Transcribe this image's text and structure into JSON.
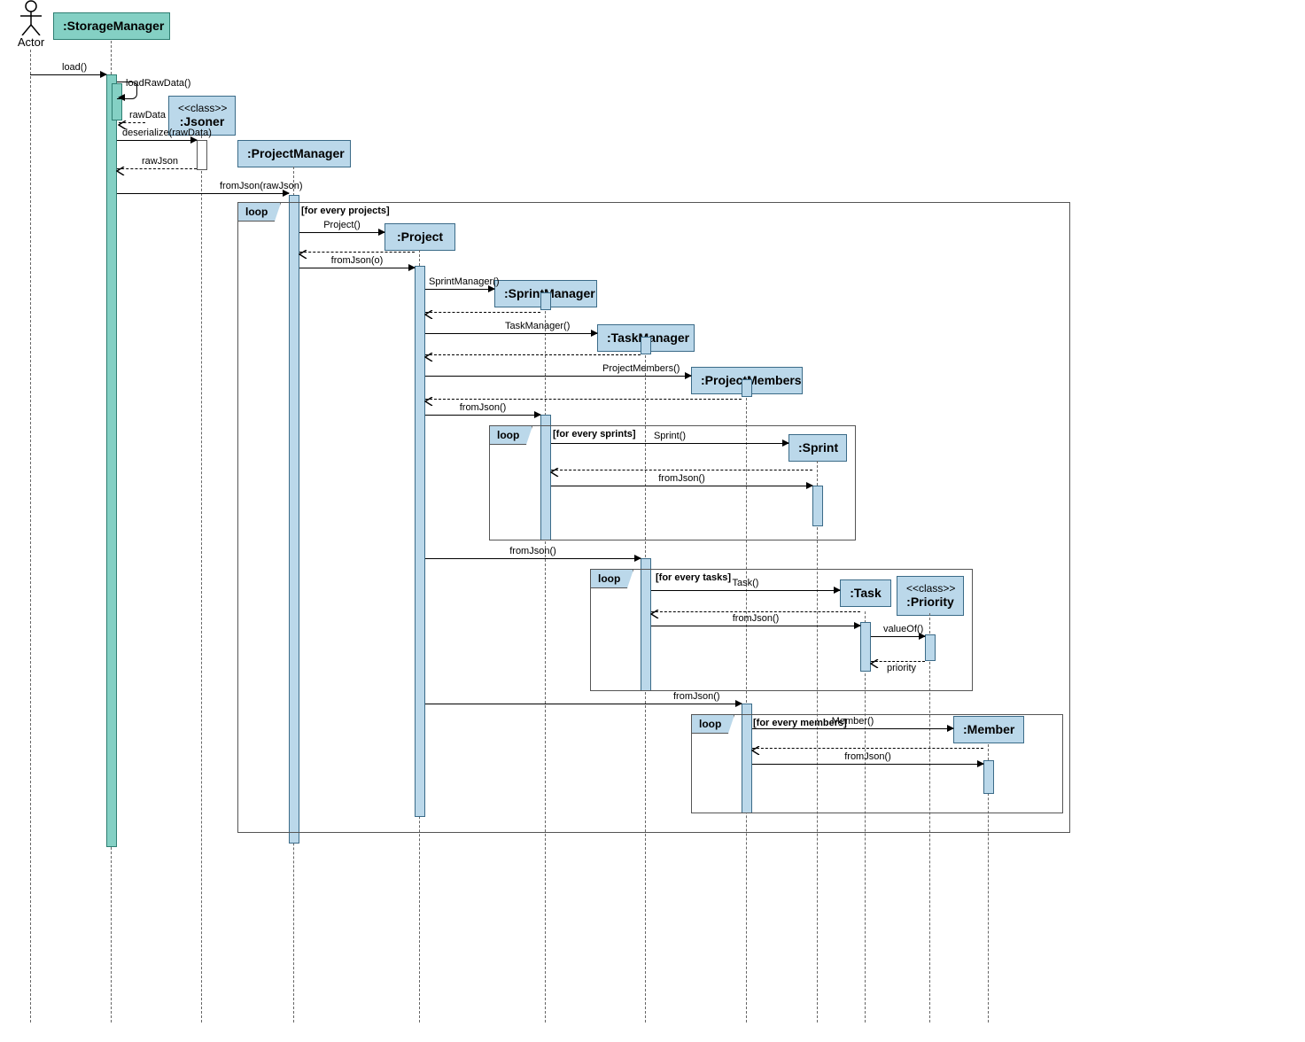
{
  "actor": {
    "label": "Actor"
  },
  "lifelines": {
    "storageManager": ":StorageManager",
    "jsoner_stereo": "<<class>>",
    "jsoner": ":Jsoner",
    "projectManager": ":ProjectManager",
    "project": ":Project",
    "sprintManager": ":SprintManager",
    "taskManager": ":TaskManager",
    "projectMembers": ":ProjectMembers",
    "sprint": ":Sprint",
    "task": ":Task",
    "priority_stereo": "<<class>>",
    "priority": ":Priority",
    "member": ":Member"
  },
  "messages": {
    "load": "load()",
    "loadRawData": "loadRawData()",
    "rawData": "rawData",
    "deserialize": "deserialize(rawData)",
    "rawJson": "rawJson",
    "fromJsonRawJson": "fromJson(rawJson)",
    "projectCtor": "Project()",
    "fromJsonO": "fromJson(o)",
    "sprintMgrCtor": "SprintManager()",
    "taskMgrCtor": "TaskManager()",
    "projMembersCtor": "ProjectMembers()",
    "fromJson": "fromJson()",
    "sprintCtor": "Sprint()",
    "taskCtor": "Task()",
    "valueOf": "valueOf()",
    "priorityRet": "priority",
    "memberCtor": "Member()"
  },
  "fragments": {
    "loop": "loop",
    "projects": "[for every projects]",
    "sprints": "[for every sprints]",
    "tasks": "[for every tasks]",
    "members": "[for every members]"
  }
}
